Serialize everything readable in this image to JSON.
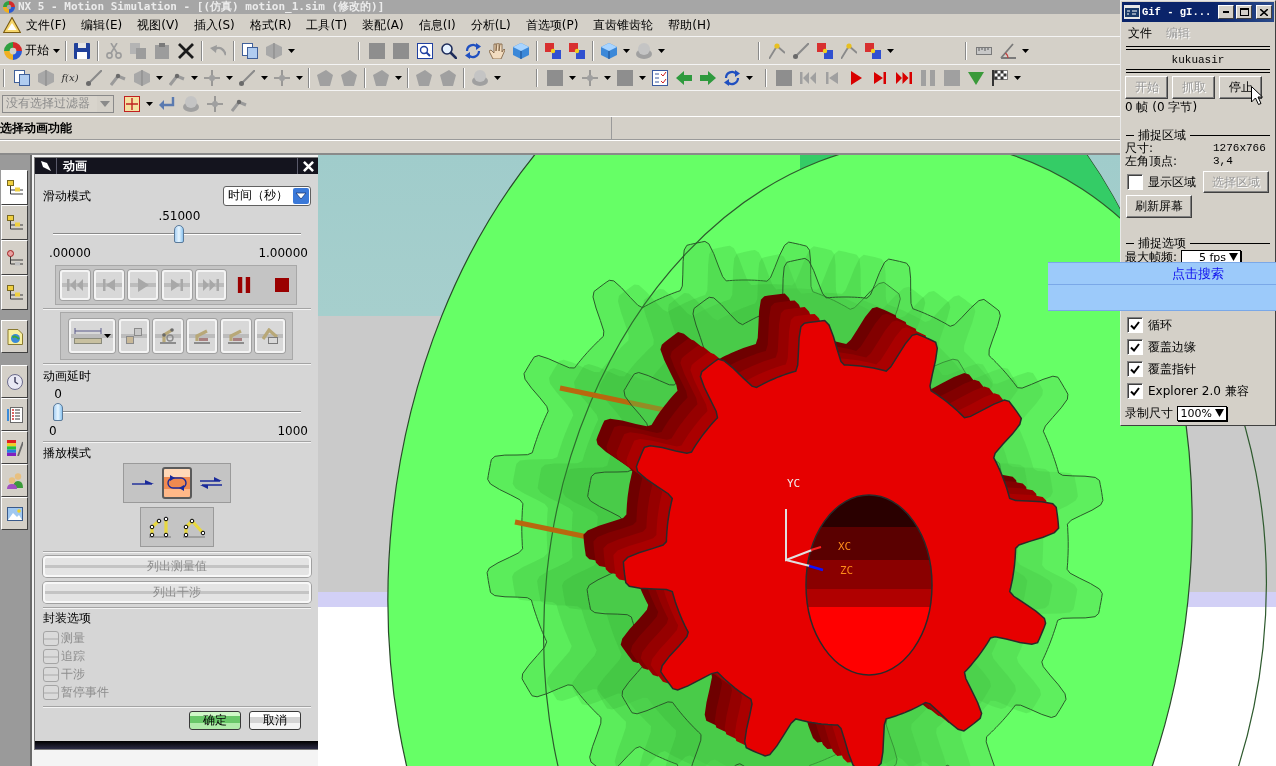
{
  "window": {
    "title": "NX 5 - Motion Simulation - [(仿真) motion_1.sim (修改的)]",
    "active": false
  },
  "menu_bar": {
    "items": [
      "文件(F)",
      "编辑(E)",
      "视图(V)",
      "插入(S)",
      "格式(R)",
      "工具(T)",
      "装配(A)",
      "信息(I)",
      "分析(L)",
      "首选项(P)",
      "直齿锥齿轮",
      "帮助(H)"
    ]
  },
  "toolbar": {
    "start_button": "开始",
    "function_button": "f(x)",
    "selection_filter": {
      "value": "没有选择过滤器",
      "disabled": true
    }
  },
  "cue_line": {
    "text": "选择动画功能"
  },
  "resource_bar": {
    "tabs": [
      {
        "selected": true
      },
      {
        "selected": false
      },
      {
        "selected": false
      },
      {
        "selected": false
      },
      {
        "selected": false
      },
      {
        "selected": false
      },
      {
        "selected": false
      },
      {
        "selected": false
      },
      {
        "selected": false
      },
      {
        "selected": false
      }
    ]
  },
  "animation_dialog": {
    "title": "动画",
    "slider_mode": {
      "label": "滑动模式",
      "value": "时间（秒）"
    },
    "time_slider": {
      "reading": ".51000",
      "level": 0.51,
      "min_label": ".00000",
      "max_label": "1.00000"
    },
    "delay": {
      "label": "动画延时",
      "reading": "0",
      "level": 0,
      "min_label": "0",
      "max_label": "1000"
    },
    "playback_mode": {
      "label": "播放模式",
      "modes": [
        {
          "kind": "once",
          "selected": false
        },
        {
          "kind": "loop",
          "selected": true
        },
        {
          "kind": "reverse",
          "selected": false
        }
      ]
    },
    "list_buttons": [
      {
        "label": "列出测量值",
        "disabled": true
      },
      {
        "label": "列出干涉",
        "disabled": true
      }
    ],
    "package_options": {
      "label": "封装选项",
      "items": [
        {
          "label": "测量",
          "checked": false,
          "disabled": true
        },
        {
          "label": "追踪",
          "checked": false,
          "disabled": true
        },
        {
          "label": "干涉",
          "checked": false,
          "disabled": true
        },
        {
          "label": "暂停事件",
          "checked": false,
          "disabled": true
        }
      ]
    },
    "buttons": [
      {
        "label": "确定",
        "kind": "primary"
      },
      {
        "label": "取消",
        "kind": "secondary"
      }
    ]
  },
  "viewport": {
    "axis_labels": {
      "y": "YC",
      "x": "XC",
      "z": "ZC"
    }
  },
  "gif_window": {
    "title": "Gif - gI...",
    "active": true,
    "menu": [
      {
        "label": "文件",
        "disabled": false
      },
      {
        "label": "编辑",
        "disabled": true
      }
    ],
    "user": "kukuasir",
    "buttons": [
      {
        "label": "开始",
        "disabled": true
      },
      {
        "label": "抓取",
        "disabled": true
      },
      {
        "label": "停止",
        "disabled": false
      }
    ],
    "status": "0 帧 (0 字节)",
    "capture_area": {
      "title": "捕捉区域",
      "fields": [
        {
          "label": "尺寸:",
          "value": "1276x766"
        },
        {
          "label": "左角顶点:",
          "value": "3,4"
        }
      ],
      "show_area": {
        "label": "显示区域",
        "checked": false
      },
      "select_button": {
        "label": "选择区域",
        "disabled": true
      },
      "refresh_button": {
        "label": "刷新屏幕"
      }
    },
    "capture_options": {
      "title": "捕捉选项",
      "max_fps": {
        "label": "最大帧频:",
        "value": "5 fps"
      },
      "options": [
        {
          "label": "循环",
          "checked": true
        },
        {
          "label": "覆盖边缘",
          "checked": true
        },
        {
          "label": "覆盖指针",
          "checked": true
        },
        {
          "label": "Explorer 2.0 兼容",
          "checked": true
        }
      ],
      "record_size": {
        "label": "录制尺寸",
        "value": "100%"
      }
    }
  },
  "search_popup": {
    "link": "点击搜索"
  }
}
